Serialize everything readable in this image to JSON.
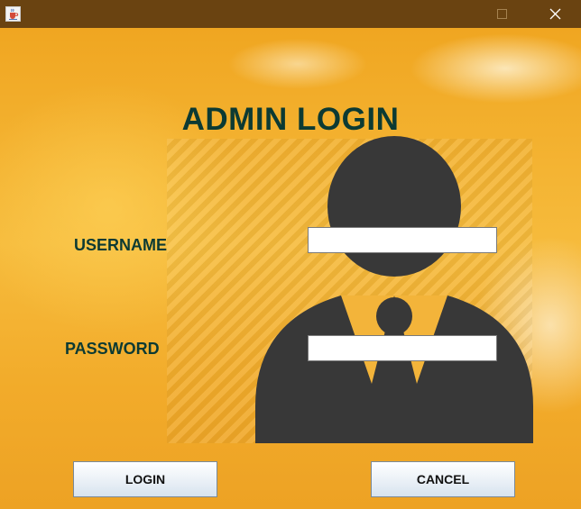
{
  "window": {
    "app_icon": "java-cup-icon",
    "controls": [
      "minimize-icon",
      "maximize-icon",
      "close-icon"
    ]
  },
  "form": {
    "title": "ADMIN LOGIN",
    "username_label": "USERNAME",
    "username_value": "",
    "password_label": "PASSWORD",
    "password_value": ""
  },
  "buttons": {
    "login_label": "LOGIN",
    "cancel_label": "CANCEL"
  },
  "illustration": "person-silhouette-icon",
  "colors": {
    "title_bar": "#6a4311",
    "label_text": "#0c3a33",
    "silhouette": "#383838",
    "background": "#f0a41e"
  }
}
